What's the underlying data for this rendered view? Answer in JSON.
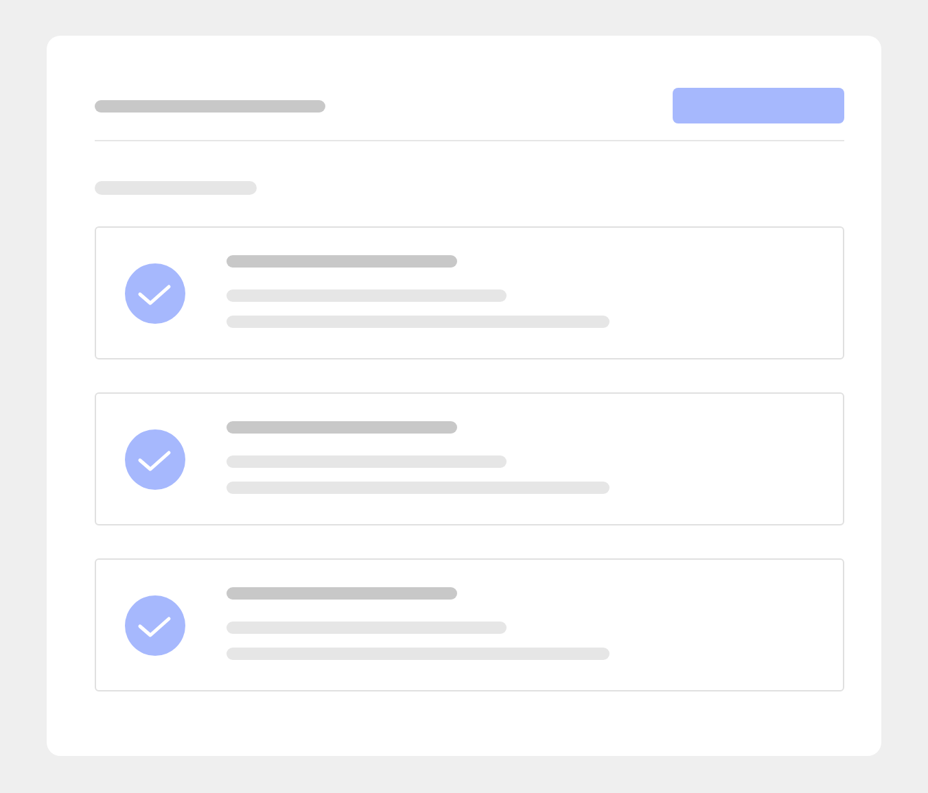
{
  "items": [
    {
      "checked": true
    },
    {
      "checked": true
    },
    {
      "checked": true
    }
  ]
}
